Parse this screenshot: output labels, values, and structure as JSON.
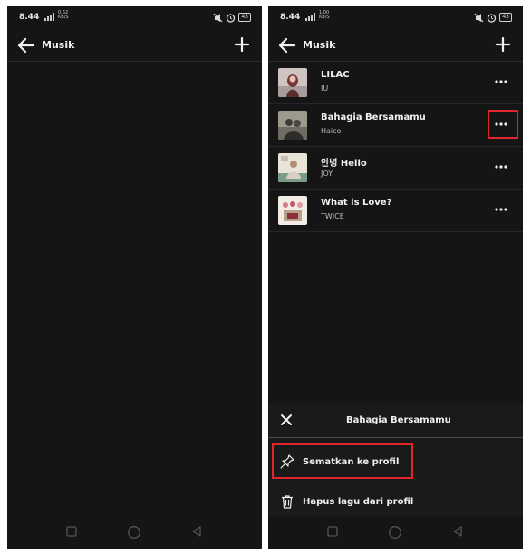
{
  "left_screen": {
    "status": {
      "time": "8.44",
      "network": "0,62\nKB/S",
      "battery": "43"
    },
    "appbar": {
      "title": "Musik"
    }
  },
  "right_screen": {
    "status": {
      "time": "8.44",
      "network": "1,00\nKB/S",
      "battery": "43"
    },
    "appbar": {
      "title": "Musik"
    },
    "songs": [
      {
        "title": "LILAC",
        "artist": "IU"
      },
      {
        "title": "Bahagia Bersamamu",
        "artist": "Haico"
      },
      {
        "title": "안녕 Hello",
        "artist": "JOY"
      },
      {
        "title": "What is Love?",
        "artist": "TWICE"
      }
    ],
    "sheet": {
      "title": "Bahagia Bersamamu",
      "actions": [
        {
          "label": "Sematkan ke profil",
          "icon": "pin-icon"
        },
        {
          "label": "Hapus lagu dari profil",
          "icon": "trash-icon"
        }
      ]
    }
  },
  "icons": [
    "back-arrow-icon",
    "plus-icon",
    "more-icon",
    "close-icon",
    "pin-icon",
    "trash-icon",
    "nav-square-icon",
    "nav-circle-icon",
    "nav-back-icon"
  ],
  "colors": {
    "background": "#151515",
    "highlight": "#e0262b",
    "text": "#f0f0f0"
  }
}
